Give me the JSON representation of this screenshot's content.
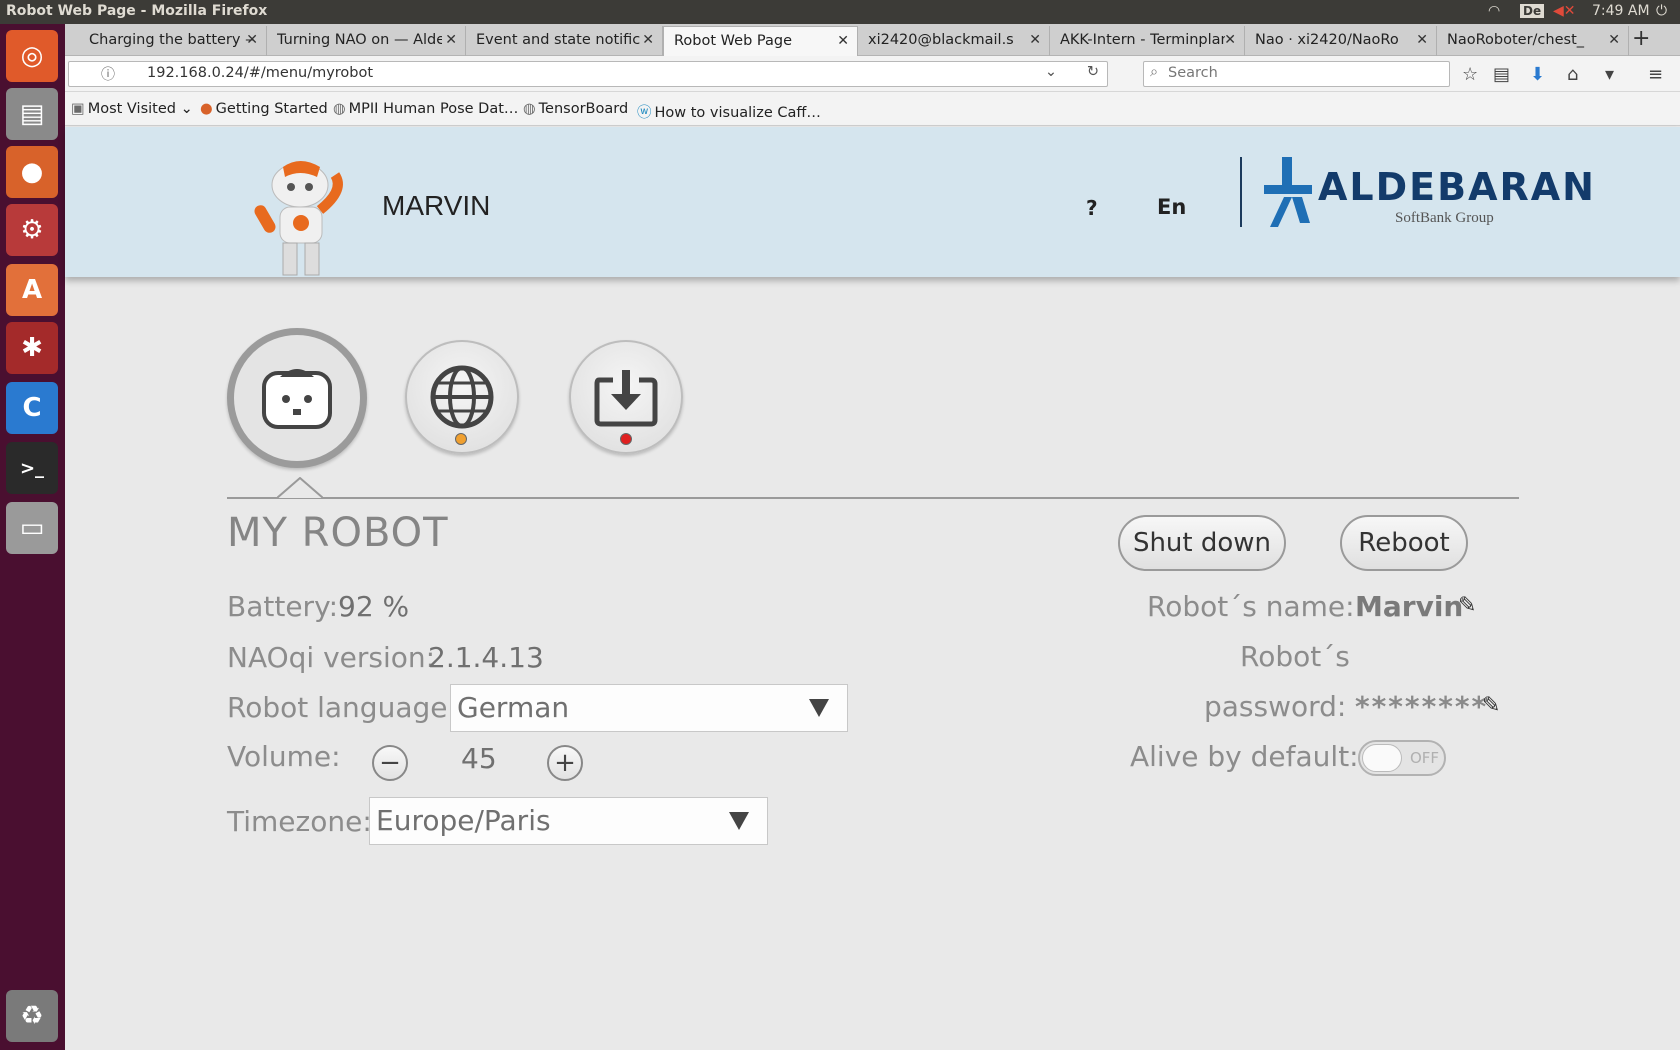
{
  "system": {
    "window_title": "Robot Web Page - Mozilla Firefox",
    "keyboard_layout": "De",
    "clock": "7:49 AM"
  },
  "tabs": [
    {
      "label": "Charging the battery —",
      "active": false
    },
    {
      "label": "Turning NAO on — Alde",
      "active": false
    },
    {
      "label": "Event and state notific",
      "active": false
    },
    {
      "label": "Robot Web Page",
      "active": true
    },
    {
      "label": "xi2420@blackmail.s",
      "active": false
    },
    {
      "label": "AKK-Intern - Terminplan",
      "active": false
    },
    {
      "label": "Nao · xi2420/NaoRo",
      "active": false
    },
    {
      "label": "NaoRoboter/chest_",
      "active": false
    }
  ],
  "nav": {
    "url": "192.168.0.24/#/menu/myrobot",
    "search_placeholder": "Search"
  },
  "bookmarks": [
    "Most Visited",
    "Getting Started",
    "MPII Human Pose Dat…",
    "TensorBoard",
    "How to visualize Caff…"
  ],
  "header": {
    "robot_name": "MARVIN",
    "help": "?",
    "language": "En",
    "brand": "ALDEBARAN",
    "sub_brand": "SoftBank Group"
  },
  "menu_icons": [
    "robot-icon",
    "network-icon",
    "update-icon"
  ],
  "status_dots": {
    "network": "#f0a030",
    "update": "#e02020"
  },
  "section": {
    "title": "MY ROBOT",
    "shutdown_label": "Shut down",
    "reboot_label": "Reboot"
  },
  "left": {
    "battery_label": "Battery:",
    "battery_value": "92 %",
    "naoqi_label": "NAOqi version:",
    "naoqi_value": "2.1.4.13",
    "language_label": "Robot language:",
    "language_value": "German",
    "volume_label": "Volume:",
    "volume_value": "45",
    "volume_minus": "−",
    "volume_plus": "+",
    "timezone_label": "Timezone:",
    "timezone_value": "Europe/Paris"
  },
  "right": {
    "name_label": "Robot´s name:",
    "name_value": "Marvin",
    "password_label_1": "Robot´s",
    "password_label_2": "password:",
    "password_value": "********",
    "alive_label": "Alive by default:",
    "alive_state": "OFF"
  },
  "colors": {
    "header_bg": "#d5e5ee",
    "brand_blue": "#1f6fb5",
    "launcher_bg": "#4a0f30"
  }
}
